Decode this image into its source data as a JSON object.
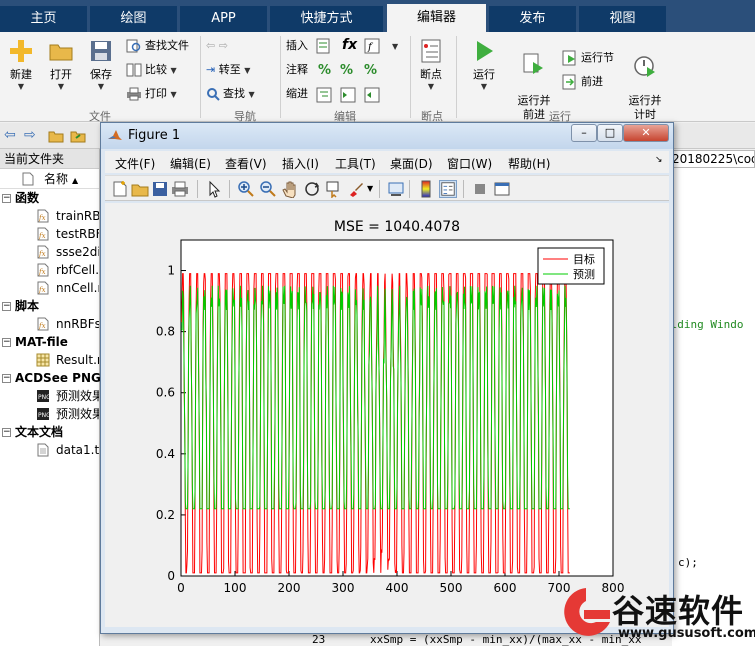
{
  "ribbon_tabs": [
    "主页",
    "绘图",
    "APP",
    "快捷方式",
    "编辑器",
    "发布",
    "视图"
  ],
  "active_tab": "编辑器",
  "ribbon": {
    "new_label": "新建",
    "open_label": "打开",
    "save_label": "保存",
    "find_files_label": "查找文件",
    "compare_label": "比较",
    "print_label": "打印",
    "goto_label": "转至",
    "find_label": "查找",
    "insert_label": "插入",
    "comment_label": "注释",
    "indent_label": "缩进",
    "fx_label": "fx",
    "breakpoints_label": "断点",
    "run_label": "运行",
    "run_advance_label": "运行并\n前进",
    "run_section_label": "运行节",
    "advance_label": "前进",
    "run_time_label": "运行并\n计时",
    "group_file": "文件",
    "group_nav": "导航",
    "group_edit": "编辑",
    "group_breakpoints": "断点",
    "group_run": "运行"
  },
  "address_right": "20180225\\cod",
  "left_panel": {
    "title": "当前文件夹",
    "column_name": "名称",
    "sections": [
      {
        "name": "函数",
        "items": [
          "trainRB",
          "testRBF",
          "ssse2di",
          "rbfCell.",
          "nnCell.r"
        ]
      },
      {
        "name": "脚本",
        "items": [
          "nnRBFs"
        ]
      },
      {
        "name": "MAT-file",
        "items": [
          "Result.n"
        ]
      },
      {
        "name": "ACDSee PNG",
        "items": [
          "预测效果",
          "预测效果"
        ]
      },
      {
        "name": "文本文档",
        "items": [
          "data1.tx"
        ]
      }
    ]
  },
  "editor_fragments": {
    "line1": "ilding Windo",
    "line2": "c);",
    "line_no": "23",
    "line_code": "xxSmp = (xxSmp - min_xx)/(max_xx - min_xx"
  },
  "figure": {
    "title": "Figure 1",
    "menu": [
      "文件(F)",
      "编辑(E)",
      "查看(V)",
      "插入(I)",
      "工具(T)",
      "桌面(D)",
      "窗口(W)",
      "帮助(H)"
    ]
  },
  "chart_data": {
    "type": "line",
    "title": "MSE = 1040.4078",
    "xlim": [
      0,
      800
    ],
    "ylim": [
      0,
      1.1
    ],
    "xticks": [
      0,
      100,
      200,
      300,
      400,
      500,
      600,
      700,
      800
    ],
    "yticks": [
      0,
      0.2,
      0.4,
      0.6,
      0.8,
      1
    ],
    "legend_position": "top-right",
    "series": [
      {
        "name": "目标",
        "color": "#ff0000",
        "x_range": [
          1,
          720
        ]
      },
      {
        "name": "预测",
        "color": "#00cc00",
        "x_range": [
          1,
          720
        ]
      }
    ]
  },
  "watermark": {
    "text": "谷速软件",
    "url": "www.gususoft.com"
  },
  "colors": {
    "tab_bg": "#0f3a68",
    "ribbon_bg": "#f3f3f3",
    "target_line": "#ff0000",
    "predict_line": "#00cc00"
  }
}
